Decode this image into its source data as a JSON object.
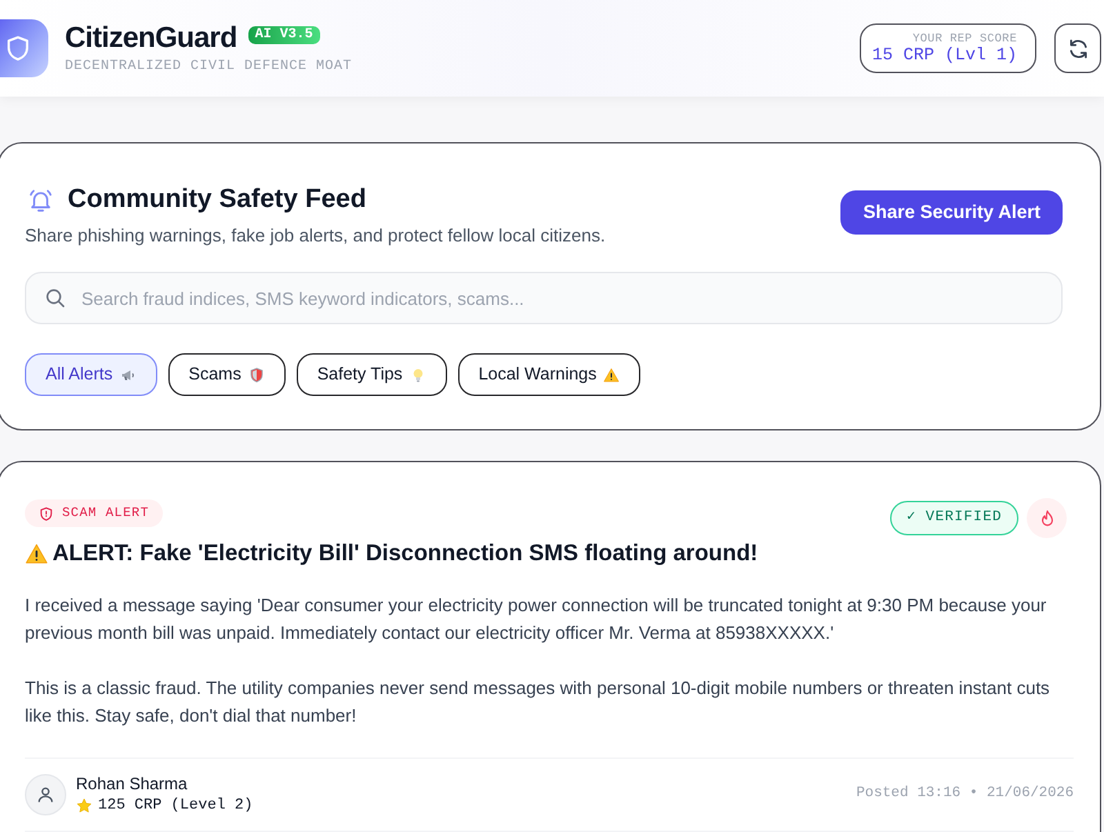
{
  "header": {
    "title": "CitizenGuard",
    "version_badge": "AI V3.5",
    "tagline": "DECENTRALIZED CIVIL DEFENCE MOAT",
    "rep_score": {
      "label": "YOUR REP SCORE",
      "value": "15 CRP (Lvl 1)"
    }
  },
  "feed": {
    "title": "Community Safety Feed",
    "subtitle": "Share phishing warnings, fake job alerts, and protect fellow local citizens.",
    "share_button": "Share Security Alert",
    "search": {
      "placeholder": "Search fraud indices, SMS keyword indicators, scams..."
    },
    "filters": [
      {
        "label": "All Alerts",
        "kind": "all",
        "selected": true
      },
      {
        "label": "Scams",
        "kind": "scam",
        "selected": false
      },
      {
        "label": "Safety Tips",
        "kind": "tip",
        "selected": false
      },
      {
        "label": "Local Warnings",
        "kind": "warning",
        "selected": false
      }
    ]
  },
  "posts": [
    {
      "category": "SCAM ALERT",
      "verified": true,
      "verified_label": "✓ VERIFIED",
      "title": "ALERT: Fake 'Electricity Bill' Disconnection SMS floating around!",
      "body": [
        "I received a message saying 'Dear consumer your electricity power connection will be truncated tonight at 9:30 PM because your previous month bill was unpaid. Immediately contact our electricity officer Mr. Verma at 85938XXXXX.'",
        "This is a classic fraud. The utility companies never send messages with personal 10-digit mobile numbers or threaten instant cuts like this. Stay safe, don't dial that number!"
      ],
      "author": {
        "name": "Rohan Sharma",
        "reputation": "125 CRP (Level 2)"
      },
      "posted": "Posted 13:16 • 21/06/2026"
    }
  ]
}
